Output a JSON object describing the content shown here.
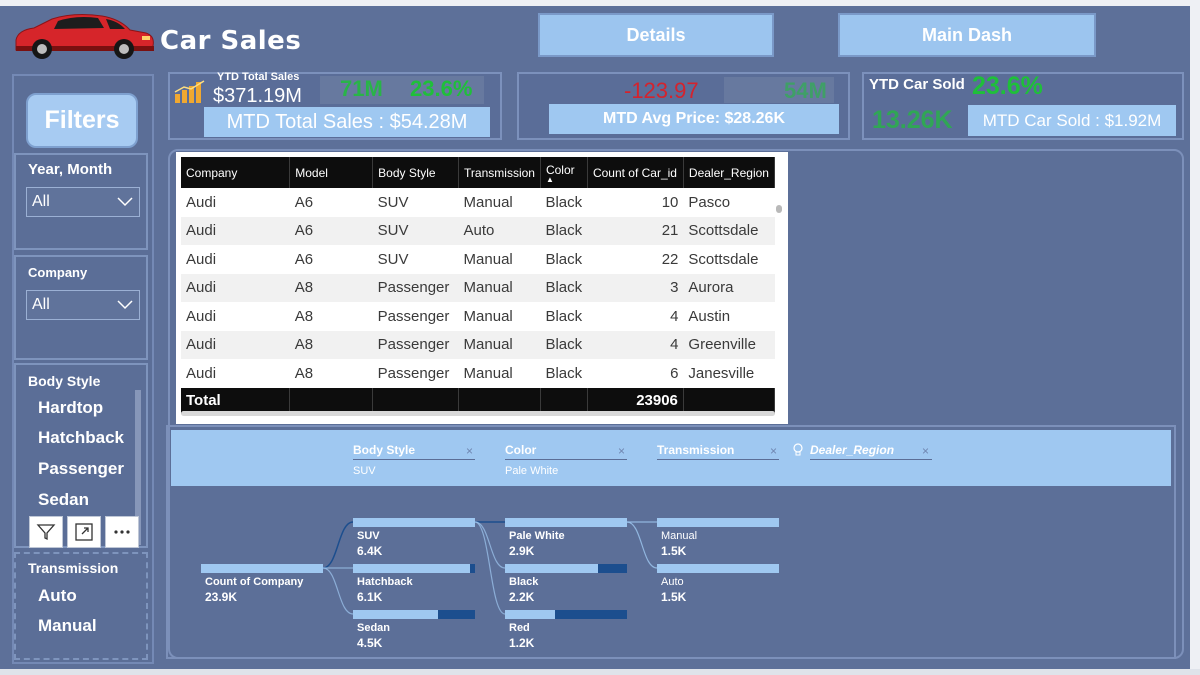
{
  "header": {
    "title": "Car Sales",
    "nav": {
      "details": "Details",
      "main_dash": "Main Dash"
    }
  },
  "filters": {
    "button": "Filters",
    "year_month": {
      "title": "Year, Month",
      "value": "All"
    },
    "company": {
      "title": "Company",
      "value": "All"
    },
    "body_style": {
      "title": "Body Style",
      "items": [
        "Hardtop",
        "Hatchback",
        "Passenger",
        "Sedan"
      ]
    },
    "transmission": {
      "title": "Transmission",
      "items": [
        "Auto",
        "Manual"
      ]
    }
  },
  "kpi": {
    "ytd_total_sales": {
      "label": "YTD Total Sales",
      "value": "$371.19M",
      "dim_value": "71M",
      "growth": "23.6%",
      "mtd_label": "MTD Total Sales : $54.28M"
    },
    "mtd_avg": {
      "change": "-123.97",
      "dim_value": "54M",
      "label": "MTD Avg Price: $28.26K"
    },
    "ytd_car_sold": {
      "label": "YTD Car Sold",
      "growth": "23.6%",
      "value": "13.26K",
      "mtd_label": "MTD Car Sold : $1.92M"
    },
    "colors": {
      "green": "#1fbf3a",
      "red": "#d4232d",
      "accent": "#9fc8f1"
    }
  },
  "table": {
    "columns": [
      "Company",
      "Model",
      "Body Style",
      "Transmission",
      "Color",
      "Count of Car_id",
      "Dealer_Region"
    ],
    "rows": [
      [
        "Audi",
        "A6",
        "SUV",
        "Manual",
        "Black",
        "10",
        "Pasco"
      ],
      [
        "Audi",
        "A6",
        "SUV",
        "Auto",
        "Black",
        "21",
        "Scottsdale"
      ],
      [
        "Audi",
        "A6",
        "SUV",
        "Manual",
        "Black",
        "22",
        "Scottsdale"
      ],
      [
        "Audi",
        "A8",
        "Passenger",
        "Manual",
        "Black",
        "3",
        "Aurora"
      ],
      [
        "Audi",
        "A8",
        "Passenger",
        "Manual",
        "Black",
        "4",
        "Austin"
      ],
      [
        "Audi",
        "A8",
        "Passenger",
        "Manual",
        "Black",
        "4",
        "Greenville"
      ],
      [
        "Audi",
        "A8",
        "Passenger",
        "Manual",
        "Black",
        "6",
        "Janesville"
      ]
    ],
    "total": {
      "label": "Total",
      "value": "23906"
    }
  },
  "tree": {
    "levels": [
      {
        "label": "Body Style",
        "selected": "SUV"
      },
      {
        "label": "Color",
        "selected": "Pale White"
      },
      {
        "label": "Transmission",
        "selected": ""
      },
      {
        "label": "Dealer_Region",
        "selected": ""
      }
    ],
    "root": {
      "label": "Count of Company",
      "value": "23.9K",
      "ratio": 1.0
    },
    "body_style": [
      {
        "label": "SUV",
        "value": "6.4K",
        "ratio": 1.0
      },
      {
        "label": "Hatchback",
        "value": "6.1K",
        "ratio": 0.96
      },
      {
        "label": "Sedan",
        "value": "4.5K",
        "ratio": 0.7
      }
    ],
    "color": [
      {
        "label": "Pale White",
        "value": "2.9K",
        "ratio": 1.0
      },
      {
        "label": "Black",
        "value": "2.2K",
        "ratio": 0.76
      },
      {
        "label": "Red",
        "value": "1.2K",
        "ratio": 0.41
      }
    ],
    "transmission": [
      {
        "label": "Manual",
        "value": "1.5K",
        "ratio": 1.0
      },
      {
        "label": "Auto",
        "value": "1.5K",
        "ratio": 1.0
      }
    ]
  }
}
